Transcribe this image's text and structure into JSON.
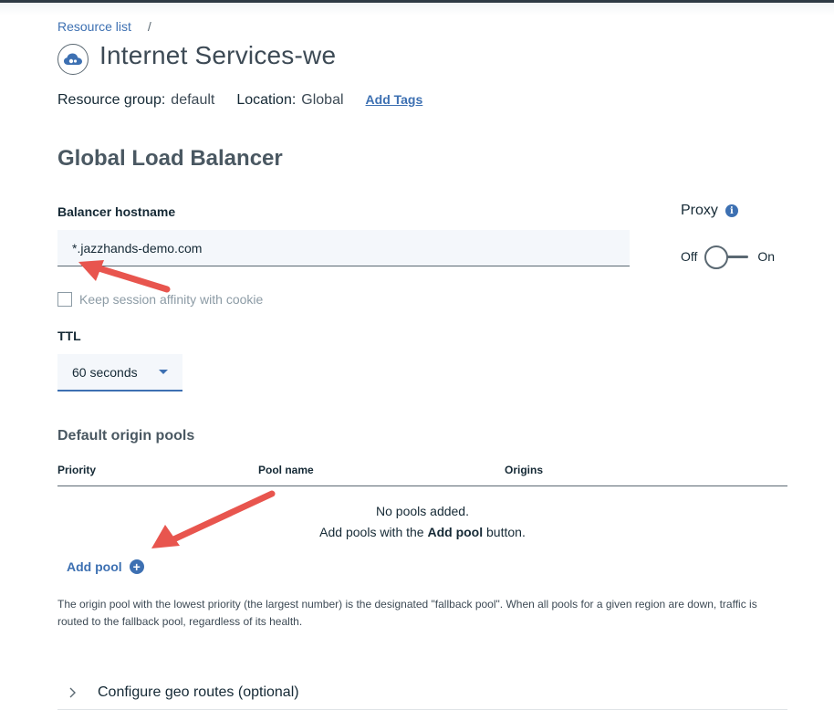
{
  "breadcrumb": {
    "link": "Resource list",
    "separator": "/"
  },
  "header": {
    "title": "Internet Services-we",
    "icon": "cloud-icon"
  },
  "meta": {
    "resource_group_label": "Resource group:",
    "resource_group_value": "default",
    "location_label": "Location:",
    "location_value": "Global",
    "add_tags": "Add Tags"
  },
  "section": {
    "title": "Global Load Balancer"
  },
  "hostname": {
    "label": "Balancer hostname",
    "value": "*.jazzhands-demo.com"
  },
  "proxy": {
    "label": "Proxy",
    "off_label": "Off",
    "on_label": "On",
    "state": "off"
  },
  "affinity": {
    "label": "Keep session affinity with cookie",
    "checked": false
  },
  "ttl": {
    "label": "TTL",
    "selected": "60 seconds"
  },
  "pools": {
    "title": "Default origin pools",
    "columns": [
      "Priority",
      "Pool name",
      "Origins"
    ],
    "empty_line1": "No pools added.",
    "empty_line2_prefix": "Add pools with the ",
    "empty_line2_bold": "Add pool",
    "empty_line2_suffix": " button.",
    "add_button": "Add pool",
    "helper": "The origin pool with the lowest priority (the largest number) is the designated \"fallback pool\". When all pools for a given region are down, traffic is routed to the fallback pool, regardless of its health."
  },
  "geo": {
    "label": "Configure geo routes (optional)"
  },
  "colors": {
    "accent": "#3d70b2",
    "annotation_arrow": "#e8554e"
  }
}
